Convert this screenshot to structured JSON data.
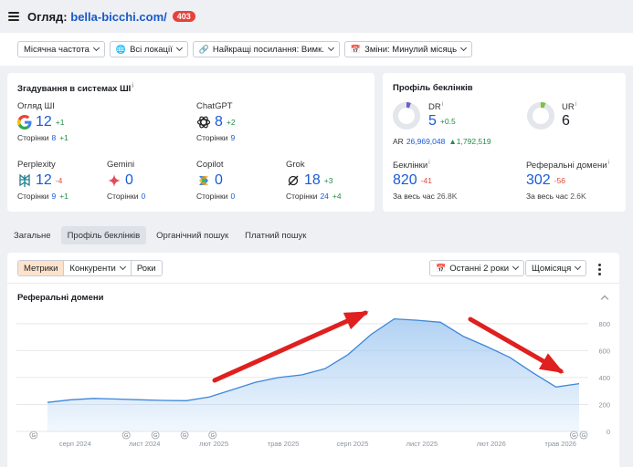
{
  "header": {
    "title_prefix": "Огляд:",
    "domain": "bella-bicchi.com/",
    "badge": "403"
  },
  "filters": [
    {
      "label": "Місячна частота",
      "icon": "none"
    },
    {
      "label": "Всі локації",
      "icon": "globe-icon"
    },
    {
      "label": "Найкращі посилання: Вимк.",
      "icon": "link-icon"
    },
    {
      "label": "Зміни: Минулий місяць",
      "icon": "calendar-icon"
    }
  ],
  "ai": {
    "title": "Згадування в системах ШІ",
    "info": "i",
    "items": [
      {
        "name": "Огляд ШІ",
        "value": "12",
        "delta": "+1",
        "pages_label": "Сторінки",
        "pages": "8",
        "pages_delta": "+1"
      },
      {
        "name": "ChatGPT",
        "value": "8",
        "delta": "+2",
        "pages_label": "Сторінки",
        "pages": "9",
        "pages_delta": ""
      },
      {
        "name": "Perplexity",
        "value": "12",
        "delta": "-4",
        "pages_label": "Сторінки",
        "pages": "9",
        "pages_delta": "+1"
      },
      {
        "name": "Gemini",
        "value": "0",
        "delta": "",
        "pages_label": "Сторінки",
        "pages": "0",
        "pages_delta": ""
      },
      {
        "name": "Copilot",
        "value": "0",
        "delta": "",
        "pages_label": "Сторінки",
        "pages": "0",
        "pages_delta": ""
      },
      {
        "name": "Grok",
        "value": "18",
        "delta": "+3",
        "pages_label": "Сторінки",
        "pages": "24",
        "pages_delta": "+4"
      }
    ]
  },
  "backlinks": {
    "title": "Профіль беклінків",
    "dr": {
      "label": "DR",
      "value": "5",
      "delta": "+0.5",
      "ar_label": "AR",
      "ar": "26,969,048",
      "ar_delta": "▲1,792,519"
    },
    "ur": {
      "label": "UR",
      "value": "6"
    },
    "links": {
      "label": "Беклінки",
      "value": "820",
      "delta": "-41",
      "all_label": "За весь час",
      "all": "26.8K"
    },
    "domains": {
      "label": "Реферальні домени",
      "value": "302",
      "delta": "-56",
      "all_label": "За весь час",
      "all": "2.6K"
    }
  },
  "tabs": [
    {
      "label": "Загальне",
      "active": false
    },
    {
      "label": "Профіль беклінків",
      "active": true
    },
    {
      "label": "Органічний пошук",
      "active": false
    },
    {
      "label": "Платний пошук",
      "active": false
    }
  ],
  "chart_controls": {
    "segments": [
      "Метрики",
      "Конкуренти",
      "Роки"
    ],
    "period": "Останні 2 роки",
    "interval": "Щомісяця"
  },
  "chart_data": {
    "type": "area",
    "title": "Реферальні домени",
    "x": [
      "2024-07",
      "2024-08",
      "2024-09",
      "2024-10",
      "2024-11",
      "2024-12",
      "2025-01",
      "2025-02",
      "2025-03",
      "2025-04",
      "2025-05",
      "2025-06",
      "2025-07",
      "2025-08",
      "2025-09",
      "2025-10",
      "2025-11",
      "2025-12",
      "2026-01",
      "2026-02",
      "2026-03",
      "2026-04",
      "2026-05",
      "2026-06"
    ],
    "values": [
      215,
      235,
      245,
      240,
      235,
      230,
      228,
      255,
      310,
      365,
      400,
      420,
      465,
      570,
      720,
      835,
      825,
      810,
      705,
      630,
      550,
      435,
      330,
      355
    ],
    "x_tick_labels": [
      "серп 2024",
      "лист 2024",
      "лют 2025",
      "трав 2025",
      "серп 2025",
      "лист 2025",
      "лют 2026",
      "трав 2026"
    ],
    "y_ticks": [
      0,
      200,
      400,
      600,
      800
    ],
    "ylim": [
      0,
      880
    ],
    "grid": true,
    "colors": {
      "line": "#3d87d9",
      "fill": "#a9cdf2",
      "arrows": "#e01f1f"
    },
    "markers": [
      "G",
      "G",
      "G",
      "G",
      "G",
      "G",
      "G"
    ]
  }
}
